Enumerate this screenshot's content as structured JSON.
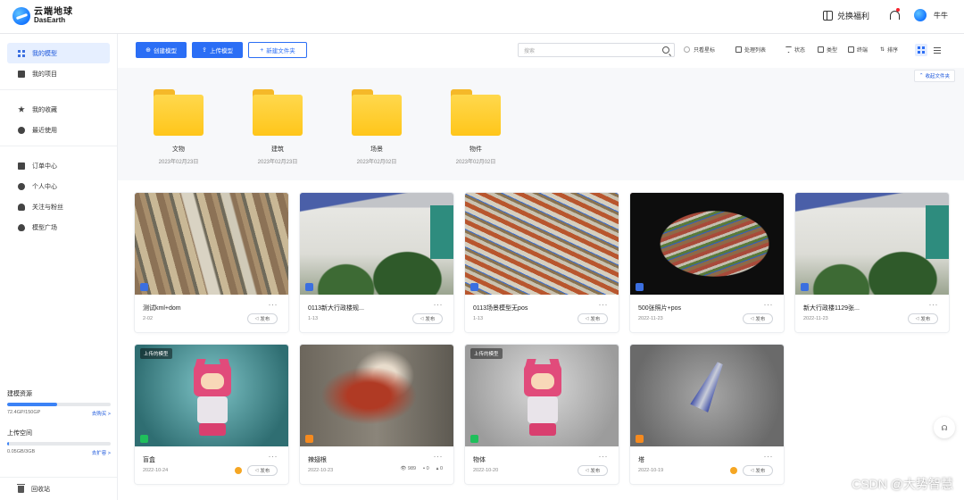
{
  "header": {
    "logo_cn": "云端地球",
    "logo_en": "DasEarth",
    "redeem": "兑换福利",
    "username": "牛牛"
  },
  "sidebar": {
    "group1": [
      {
        "label": "我的模型",
        "icon": "grid-icon",
        "active": true
      },
      {
        "label": "我的项目",
        "icon": "folder-icon",
        "active": false
      }
    ],
    "group2": [
      {
        "label": "我的收藏",
        "icon": "star-icon"
      },
      {
        "label": "最近使用",
        "icon": "clock-icon"
      }
    ],
    "group3": [
      {
        "label": "订单中心",
        "icon": "document-icon"
      },
      {
        "label": "个人中心",
        "icon": "user-circle-icon"
      },
      {
        "label": "关注与粉丝",
        "icon": "user-icon"
      },
      {
        "label": "模型广场",
        "icon": "drop-icon"
      }
    ],
    "storage": {
      "title": "建模资源",
      "usage": "72.4GP/150GP",
      "fraction": 0.48,
      "link": "去购买 >"
    },
    "upload": {
      "title": "上传空间",
      "usage": "0.05GB/3GB",
      "fraction": 0.017,
      "link": "去扩容 >"
    },
    "recycle": "回收站"
  },
  "toolbar": {
    "create_model": "创建模型",
    "upload_model": "上传模型",
    "new_folder": "新建文件夹",
    "search_placeholder": "搜索",
    "only_fav": "只看星标",
    "process_list": "处理列表",
    "status": "状态",
    "type": "类型",
    "terminal": "终端",
    "sort": "排序"
  },
  "folders": {
    "collapse": "收起文件夹",
    "items": [
      {
        "name": "文物",
        "date": "2023年02月23日"
      },
      {
        "name": "建筑",
        "date": "2023年02月23日"
      },
      {
        "name": "场景",
        "date": "2023年02月02日"
      },
      {
        "name": "物件",
        "date": "2023年02月02日"
      }
    ]
  },
  "cards": [
    {
      "title": "测试kml+dom",
      "date": "2-02",
      "action": "发布",
      "badge": "#3b6fe0",
      "more": "···"
    },
    {
      "title": "0113新大行政楼规...",
      "date": "1-13",
      "action": "发布",
      "badge": "#3b6fe0",
      "more": "···"
    },
    {
      "title": "0113场景模型无pos",
      "date": "1-13",
      "action": "发布",
      "badge": "#3b6fe0",
      "more": "···"
    },
    {
      "title": "500张照片+pos",
      "date": "2022-11-23",
      "action": "发布",
      "badge": "#3b6fe0",
      "more": "···"
    },
    {
      "title": "新大行政楼1129张...",
      "date": "2022-11-23",
      "action": "发布",
      "badge": "#3b6fe0",
      "more": "···"
    },
    {
      "title": "盲盒",
      "date": "2022-10-24",
      "action": "发布",
      "badge": "#1fbf5b",
      "tag": "上传的模型",
      "more": "···"
    },
    {
      "title": "辣翅根",
      "date": "2022-10-23",
      "badge": "#f58a1f",
      "views": "989",
      "comments": "0",
      "likes": "0",
      "more": "···"
    },
    {
      "title": "物体",
      "date": "2022-10-20",
      "action": "发布",
      "badge": "#1fbf5b",
      "tag": "上传的模型",
      "more": "···"
    },
    {
      "title": "塔",
      "date": "2022-10-19",
      "action": "发布",
      "badge": "#f58a1f",
      "more": "···"
    }
  ],
  "watermark": "CSDN @大势智慧"
}
